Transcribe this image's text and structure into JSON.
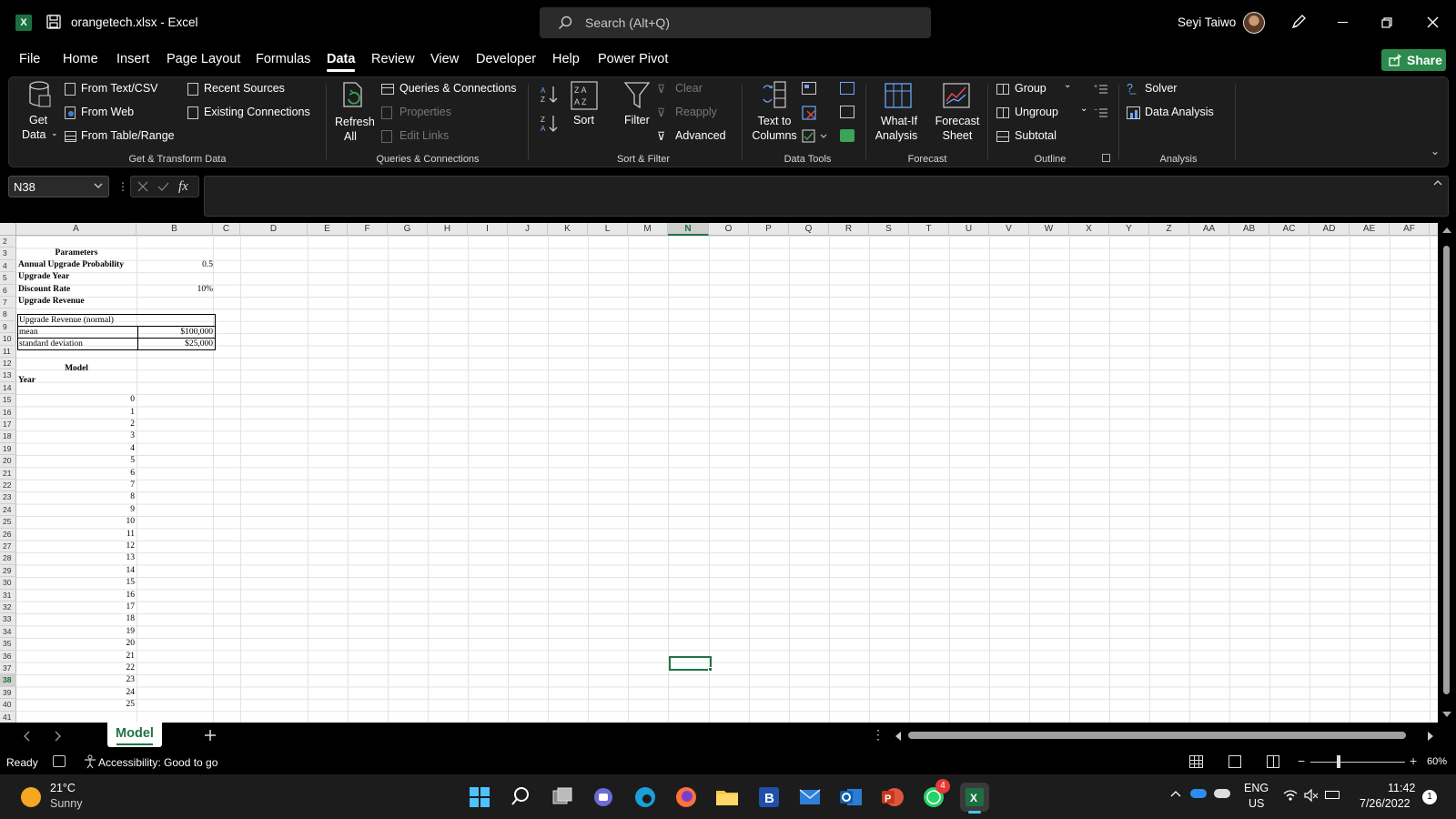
{
  "window": {
    "title": "orangetech.xlsx  -  Excel",
    "search_placeholder": "Search (Alt+Q)",
    "user": "Seyi Taiwo"
  },
  "menu": {
    "items": [
      "File",
      "Home",
      "Insert",
      "Page Layout",
      "Formulas",
      "Data",
      "Review",
      "View",
      "Developer",
      "Help",
      "Power Pivot"
    ],
    "active": "Data",
    "share_label": "Share"
  },
  "ribbon": {
    "get_transform": {
      "get_data": "Get",
      "get_data2": "Data",
      "from_text": "From Text/CSV",
      "from_web": "From Web",
      "from_table": "From Table/Range",
      "recent": "Recent Sources",
      "existing": "Existing Connections",
      "label": "Get & Transform Data"
    },
    "queries": {
      "refresh": "Refresh",
      "refresh2": "All",
      "queries_conn": "Queries & Connections",
      "properties": "Properties",
      "edit_links": "Edit Links",
      "label": "Queries & Connections"
    },
    "sort_filter": {
      "sort": "Sort",
      "filter": "Filter",
      "clear": "Clear",
      "reapply": "Reapply",
      "advanced": "Advanced",
      "label": "Sort & Filter"
    },
    "data_tools": {
      "text_to_columns": "Text to",
      "text_to_columns2": "Columns",
      "label": "Data Tools"
    },
    "forecast": {
      "what_if": "What-If",
      "what_if2": "Analysis",
      "forecast_sheet": "Forecast",
      "forecast_sheet2": "Sheet",
      "label": "Forecast"
    },
    "outline": {
      "group": "Group",
      "ungroup": "Ungroup",
      "subtotal": "Subtotal",
      "label": "Outline"
    },
    "analysis": {
      "solver": "Solver",
      "data_analysis": "Data Analysis",
      "label": "Analysis"
    }
  },
  "formula_bar": {
    "name_box": "N38",
    "formula": ""
  },
  "columns": [
    "A",
    "B",
    "C",
    "D",
    "E",
    "F",
    "G",
    "H",
    "I",
    "J",
    "K",
    "L",
    "M",
    "N",
    "O",
    "P",
    "Q",
    "R",
    "S",
    "T",
    "U",
    "V",
    "W",
    "X",
    "Y",
    "Z",
    "AA",
    "AB",
    "AC",
    "AD",
    "AE",
    "AF"
  ],
  "selected_column": "N",
  "rows": [
    "2",
    "3",
    "4",
    "5",
    "6",
    "7",
    "8",
    "9",
    "10",
    "11",
    "12",
    "13",
    "14",
    "15",
    "16",
    "17",
    "18",
    "19",
    "20",
    "21",
    "22",
    "23",
    "24",
    "25",
    "26",
    "27",
    "28",
    "29",
    "30",
    "31",
    "32",
    "33",
    "34",
    "35",
    "36",
    "37",
    "38",
    "39",
    "40",
    "41"
  ],
  "selected_row": "38",
  "sheet": {
    "parameters_title": "Parameters",
    "annual_upgrade_prob_label": "Annual Upgrade Probability",
    "annual_upgrade_prob_value": "0.5",
    "upgrade_year_label": "Upgrade Year",
    "discount_rate_label": "Discount Rate",
    "discount_rate_value": "10%",
    "upgrade_revenue_label": "Upgrade Revenue",
    "normal_title": "Upgrade Revenue (normal)",
    "mean_label": "mean",
    "mean_value": "$100,000",
    "sd_label": "standard deviation",
    "sd_value": "$25,000",
    "model_title": "Model",
    "year_label": "Year",
    "years": [
      "0",
      "1",
      "2",
      "3",
      "4",
      "5",
      "6",
      "7",
      "8",
      "9",
      "10",
      "11",
      "12",
      "13",
      "14",
      "15",
      "16",
      "17",
      "18",
      "19",
      "20",
      "21",
      "22",
      "23",
      "24",
      "25"
    ]
  },
  "sheet_tabs": {
    "active": "Model"
  },
  "status": {
    "ready": "Ready",
    "accessibility": "Accessibility: Good to go",
    "zoom": "60%"
  },
  "taskbar": {
    "weather_temp": "21°C",
    "weather_desc": "Sunny",
    "lang1": "ENG",
    "lang2": "US",
    "time": "11:42",
    "date": "7/26/2022",
    "whatsapp_badge": "4",
    "notif_count": "1"
  }
}
